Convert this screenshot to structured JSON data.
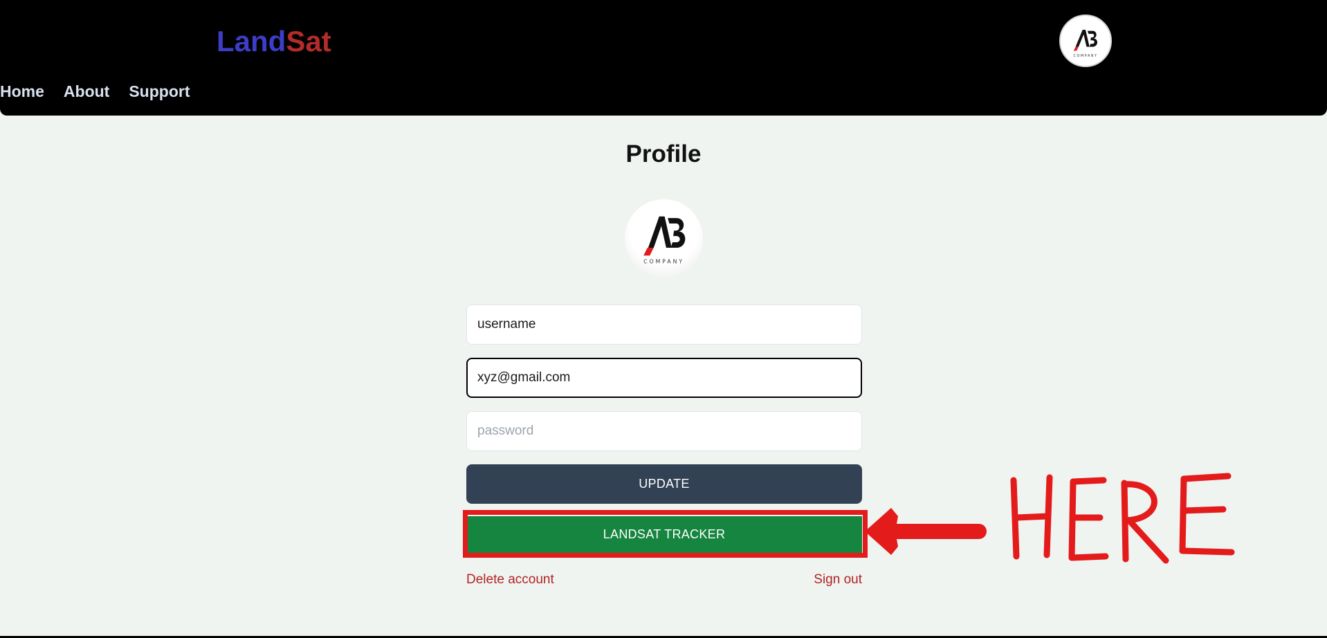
{
  "header": {
    "brand_part1": "Land",
    "brand_part2": "Sat",
    "nav": [
      "Home",
      "About",
      "Support"
    ],
    "avatar_icon": "ab-company-logo-icon"
  },
  "profile": {
    "title": "Profile",
    "avatar_icon": "ab-company-logo-icon",
    "logo_text": "COMPANY"
  },
  "form": {
    "username_value": "username",
    "email_value": "xyz@gmail.com",
    "password_placeholder": "password",
    "update_label": "UPDATE",
    "tracker_label": "LANDSAT TRACKER",
    "delete_label": "Delete account",
    "signout_label": "Sign out"
  },
  "annotation": {
    "text": "HERE",
    "color": "#e31b1b"
  },
  "colors": {
    "header_bg": "#000000",
    "brand_land": "#3d3dc9",
    "brand_sat": "#b32c2a",
    "update_button": "#334155",
    "tracker_button": "#168540",
    "link_red": "#b22222"
  }
}
